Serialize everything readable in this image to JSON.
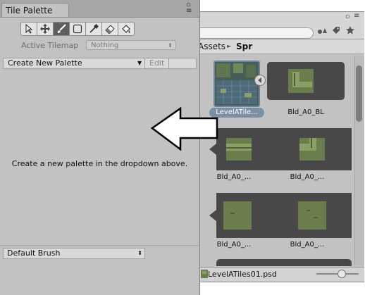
{
  "tile_palette": {
    "tab_title": "Tile Palette",
    "tools": [
      {
        "icon": "select-arrow-icon",
        "active": false
      },
      {
        "icon": "move-icon",
        "active": false
      },
      {
        "icon": "paintbrush-icon",
        "active": true
      },
      {
        "icon": "box-fill-icon",
        "active": false
      },
      {
        "icon": "eyedropper-icon",
        "active": false
      },
      {
        "icon": "eraser-icon",
        "active": false
      },
      {
        "icon": "flood-fill-icon",
        "active": false
      }
    ],
    "active_tilemap_label": "Active Tilemap",
    "active_tilemap_value": "Nothing",
    "palette_dropdown_value": "Create New Palette",
    "edit_label": "Edit",
    "empty_message": "Create a new palette in the dropdown above.",
    "brush_dropdown_value": "Default Brush"
  },
  "project": {
    "breadcrumb": [
      "Assets",
      "Spr"
    ],
    "breadcrumb_separator": "►",
    "assets": [
      {
        "label": "LevelATile...",
        "selected": true
      },
      {
        "label": "Bld_A0_BL",
        "selected": false
      },
      {
        "label": "Bld_A0_...",
        "selected": false
      },
      {
        "label": "Bld_A0_...",
        "selected": false
      },
      {
        "label": "Bld_A0_...",
        "selected": false
      },
      {
        "label": "Bld_A0_...",
        "selected": false
      }
    ],
    "status_file": "LevelATiles01.psd",
    "zoom_level": 0.6
  },
  "colors": {
    "window_bg": "#c2c2c2",
    "tile_green": "#6b7d4c",
    "sprite_group_bg": "#484848"
  }
}
